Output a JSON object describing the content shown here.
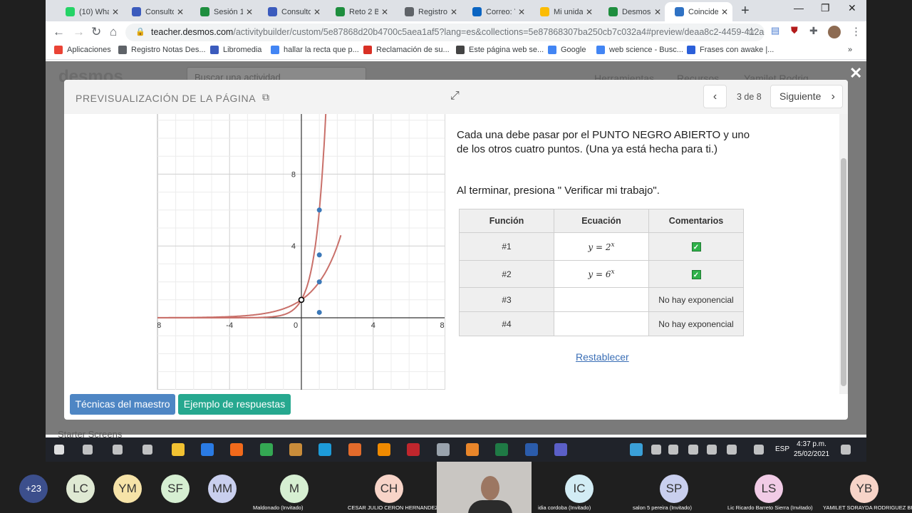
{
  "browser": {
    "tabs": [
      {
        "label": "(10) Wha",
        "color": "#25d366"
      },
      {
        "label": "Consulto",
        "color": "#3b5bbd"
      },
      {
        "label": "Sesión 1",
        "color": "#1e8e3e"
      },
      {
        "label": "Consulto",
        "color": "#3b5bbd"
      },
      {
        "label": "Reto 2 Ba",
        "color": "#1e8e3e"
      },
      {
        "label": "Registro",
        "color": "#5f6368"
      },
      {
        "label": "Correo: Y",
        "color": "#0a64c2"
      },
      {
        "label": "Mi unida",
        "color": "#fbbc04"
      },
      {
        "label": "Desmos",
        "color": "#1e8e3e"
      },
      {
        "label": "Coincide",
        "color": "#2f72c4"
      }
    ],
    "url_host": "teacher.desmos.com",
    "url_rest": "/activitybuilder/custom/5e87868d20b4700c5aea1af5?lang=es&collections=5e87868307ba250cb7c032a4#preview/deaa8c2-4459-412a-...",
    "bookmarks": [
      {
        "label": "Aplicaciones",
        "color": "#ea4335"
      },
      {
        "label": "Registro Notas Des...",
        "color": "#5f6368"
      },
      {
        "label": "Libromedia",
        "color": "#3b5bbd"
      },
      {
        "label": "hallar la recta que p...",
        "color": "#4285f4"
      },
      {
        "label": "Reclamación de su...",
        "color": "#d93025"
      },
      {
        "label": "Este página web se...",
        "color": "#444444"
      },
      {
        "label": "Google",
        "color": "#4285f4"
      },
      {
        "label": "web science - Busc...",
        "color": "#4285f4"
      },
      {
        "label": "Frases con awake |...",
        "color": "#2b5fd9"
      }
    ]
  },
  "background_page": {
    "logo": "desmos",
    "search_placeholder": "Buscar una actividad",
    "menu_tools": "Herramientas",
    "menu_resources": "Recursos",
    "user": "Yamilet Rodrig",
    "starter": "Starter Screens"
  },
  "modal": {
    "title": "PREVISUALIZACIÓN DE LA PÁGINA",
    "page_count": "3 de 8",
    "next_label": "Siguiente",
    "instruction_1": "Cada una debe pasar por el PUNTO NEGRO ABIERTO y uno de los otros cuatro puntos. (Una ya está hecha para ti.)",
    "instruction_2": "Al terminar, presiona \" Verificar mi trabajo\".",
    "table": {
      "headers": [
        "Función",
        "Ecuación",
        "Comentarios"
      ],
      "rows": [
        {
          "fn": "#1",
          "eq_base": "y = 2",
          "eq_exp": "x",
          "comment": "",
          "check": true
        },
        {
          "fn": "#2",
          "eq_base": "y = 6",
          "eq_exp": "x",
          "comment": "",
          "check": true
        },
        {
          "fn": "#3",
          "eq_base": "",
          "eq_exp": "",
          "comment": "No hay exponencial",
          "check": false
        },
        {
          "fn": "#4",
          "eq_base": "",
          "eq_exp": "",
          "comment": "No hay exponencial",
          "check": false
        }
      ]
    },
    "reset": "Restablecer",
    "teacher_btn": "Técnicas del maestro",
    "answers_btn": "Ejemplo de respuestas"
  },
  "graph": {
    "x_ticks": [
      "-8",
      "-4",
      "0",
      "4",
      "8"
    ],
    "y_ticks": [
      "4",
      "8"
    ],
    "open_point": [
      0,
      1
    ],
    "points": [
      [
        1,
        6
      ],
      [
        1,
        3.5
      ],
      [
        1,
        2
      ],
      [
        1,
        0.3
      ]
    ],
    "curves": [
      "y = 2^x",
      "y = 6^x"
    ],
    "curve_color": "#c9706a",
    "point_color": "#3b78b8"
  },
  "taskbar": {
    "lang": "ESP",
    "time": "4:37 p.m.",
    "date": "25/02/2021"
  },
  "meeting": {
    "participants": [
      {
        "initials": "+23",
        "name": "",
        "color": "#3c4f8c"
      },
      {
        "initials": "LC",
        "name": "",
        "color": "#dfe9d3"
      },
      {
        "initials": "YM",
        "name": "",
        "color": "#f6e3a8"
      },
      {
        "initials": "SF",
        "name": "",
        "color": "#d6efd2"
      },
      {
        "initials": "MM",
        "name": "",
        "color": "#c9cfee"
      },
      {
        "initials": "M",
        "name": "Maldonado (Invitado)",
        "color": "#d6efd2"
      },
      {
        "initials": "CH",
        "name": "CESAR JULIO CERON HERNANDEZ",
        "color": "#f7d4c8"
      },
      {
        "initials": "IC",
        "name": "idia cordoba (Invitado)",
        "color": "#d2ecf4"
      },
      {
        "initials": "SP",
        "name": "salon 5 pereira (Invitado)",
        "color": "#c9cfee"
      },
      {
        "initials": "LS",
        "name": "Lic Ricardo Barreto Sierra (Invitado)",
        "color": "#f1cbe6"
      },
      {
        "initials": "YB",
        "name": "YAMILET SORAYDA RODRIGUEZ BR...",
        "color": "#f7d4c8"
      }
    ]
  }
}
